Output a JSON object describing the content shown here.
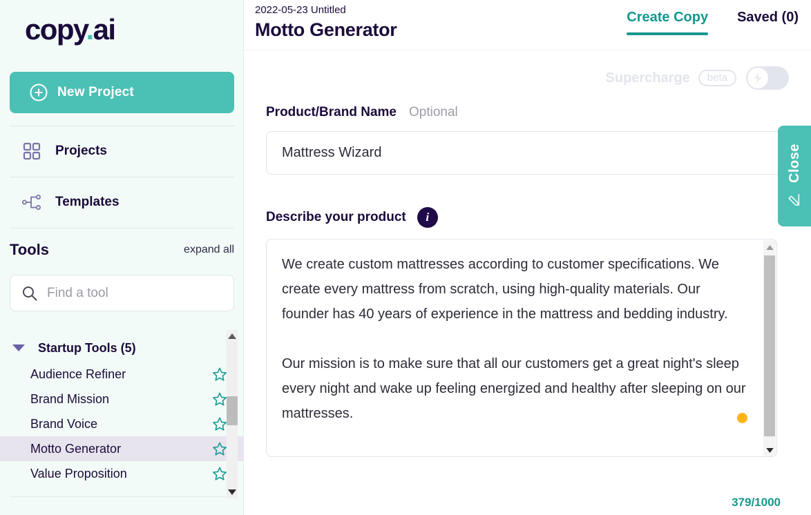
{
  "brand": {
    "name": "copy",
    "dot": ".",
    "suffix": "ai"
  },
  "colors": {
    "teal": "#4bc0b5",
    "teal_dark": "#17988e",
    "navy": "#1b0b3b",
    "amber": "#fdb515",
    "sidebar_bg": "#f2fbf7",
    "active_row": "#e8e4ee"
  },
  "sidebar": {
    "new_project_label": "New Project",
    "new_project_icon": "plus-circle-icon",
    "nav": [
      {
        "label": "Projects",
        "icon": "grid-icon"
      },
      {
        "label": "Templates",
        "icon": "hierarchy-icon"
      }
    ],
    "tools": {
      "title": "Tools",
      "expand_all": "expand all",
      "search_placeholder": "Find a tool",
      "search_value": "",
      "search_icon": "search-icon",
      "group": {
        "label": "Startup Tools (5)",
        "expanded": true,
        "items": [
          {
            "label": "Audience Refiner",
            "starred": false,
            "active": false
          },
          {
            "label": "Brand Mission",
            "starred": false,
            "active": false
          },
          {
            "label": "Brand Voice",
            "starred": false,
            "active": false
          },
          {
            "label": "Motto Generator",
            "starred": false,
            "active": true
          },
          {
            "label": "Value Proposition",
            "starred": false,
            "active": false
          }
        ]
      }
    }
  },
  "header": {
    "project_date": "2022-05-23 Untitled",
    "tool_title": "Motto Generator",
    "tabs": [
      {
        "label": "Create Copy",
        "active": true
      },
      {
        "label": "Saved (0)",
        "active": false
      }
    ]
  },
  "supercharge": {
    "label": "Supercharge",
    "badge": "beta",
    "enabled": false,
    "knob_icon": "lightning-bolt-icon"
  },
  "form": {
    "product_name": {
      "label": "Product/Brand Name",
      "optional": "Optional",
      "value": "Mattress Wizard",
      "placeholder": ""
    },
    "description": {
      "label": "Describe your product",
      "info_icon": "info-icon",
      "paragraph_1": "We create custom mattresses according to customer specifications. We create every mattress from scratch, using high-quality materials. Our founder has 40 years of experience in the mattress and bedding industry.",
      "paragraph_2": "Our mission is to make sure that all our customers get a great night's sleep every night and wake up feeling energized and healthy after sleeping on our mattresses.",
      "char_count": "379/1000"
    }
  },
  "close_panel": {
    "label": "Close",
    "icon": "pencil-icon"
  }
}
